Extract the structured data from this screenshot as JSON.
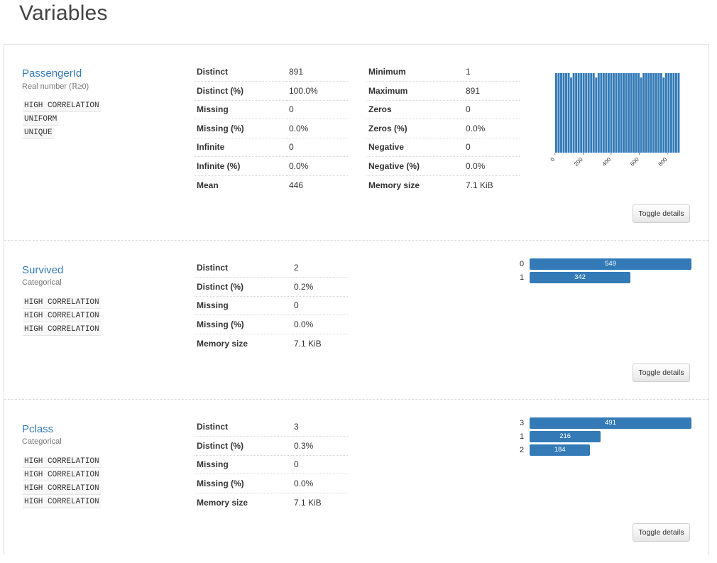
{
  "page_title": "Variables",
  "toggle_label": "Toggle details",
  "variables": [
    {
      "name": "PassengerId",
      "type": "Real number (ℝ≥0)",
      "alerts": [
        "HIGH CORRELATION",
        "UNIFORM",
        "UNIQUE"
      ],
      "stats_left": [
        {
          "k": "Distinct",
          "v": "891"
        },
        {
          "k": "Distinct (%)",
          "v": "100.0%"
        },
        {
          "k": "Missing",
          "v": "0"
        },
        {
          "k": "Missing (%)",
          "v": "0.0%"
        },
        {
          "k": "Infinite",
          "v": "0"
        },
        {
          "k": "Infinite (%)",
          "v": "0.0%"
        },
        {
          "k": "Mean",
          "v": "446"
        }
      ],
      "stats_right": [
        {
          "k": "Minimum",
          "v": "1"
        },
        {
          "k": "Maximum",
          "v": "891"
        },
        {
          "k": "Zeros",
          "v": "0"
        },
        {
          "k": "Zeros (%)",
          "v": "0.0%"
        },
        {
          "k": "Negative",
          "v": "0"
        },
        {
          "k": "Negative (%)",
          "v": "0.0%"
        },
        {
          "k": "Memory size",
          "v": "7.1 KiB"
        }
      ]
    },
    {
      "name": "Survived",
      "type": "Categorical",
      "alerts": [
        "HIGH CORRELATION",
        "HIGH CORRELATION",
        "HIGH CORRELATION"
      ],
      "stats_left": [
        {
          "k": "Distinct",
          "v": "2"
        },
        {
          "k": "Distinct (%)",
          "v": "0.2%"
        },
        {
          "k": "Missing",
          "v": "0"
        },
        {
          "k": "Missing (%)",
          "v": "0.0%"
        },
        {
          "k": "Memory size",
          "v": "7.1 KiB"
        }
      ]
    },
    {
      "name": "Pclass",
      "type": "Categorical",
      "alerts": [
        "HIGH CORRELATION",
        "HIGH CORRELATION",
        "HIGH CORRELATION",
        "HIGH CORRELATION"
      ],
      "stats_left": [
        {
          "k": "Distinct",
          "v": "3"
        },
        {
          "k": "Distinct (%)",
          "v": "0.3%"
        },
        {
          "k": "Missing",
          "v": "0"
        },
        {
          "k": "Missing (%)",
          "v": "0.0%"
        },
        {
          "k": "Memory size",
          "v": "7.1 KiB"
        }
      ]
    }
  ],
  "chart_data": [
    {
      "type": "bar",
      "variable": "PassengerId",
      "x_ticks": [
        "0",
        "200",
        "400",
        "600",
        "800"
      ],
      "xlim": [
        1,
        891
      ],
      "bin_count": 50,
      "values": [
        18,
        18,
        18,
        18,
        18,
        18,
        17,
        18,
        18,
        18,
        18,
        18,
        18,
        18,
        18,
        18,
        17,
        18,
        18,
        18,
        18,
        18,
        18,
        18,
        18,
        18,
        18,
        18,
        18,
        18,
        18,
        18,
        18,
        18,
        17,
        18,
        18,
        18,
        18,
        18,
        18,
        18,
        18,
        17,
        18,
        18,
        18,
        18,
        18,
        18
      ],
      "color": "#337ab7"
    },
    {
      "type": "bar",
      "orientation": "horizontal",
      "variable": "Survived",
      "categories": [
        "0",
        "1"
      ],
      "values": [
        549,
        342
      ],
      "color": "#337ab7"
    },
    {
      "type": "bar",
      "orientation": "horizontal",
      "variable": "Pclass",
      "categories": [
        "3",
        "1",
        "2"
      ],
      "values": [
        491,
        216,
        184
      ],
      "color": "#337ab7"
    }
  ]
}
